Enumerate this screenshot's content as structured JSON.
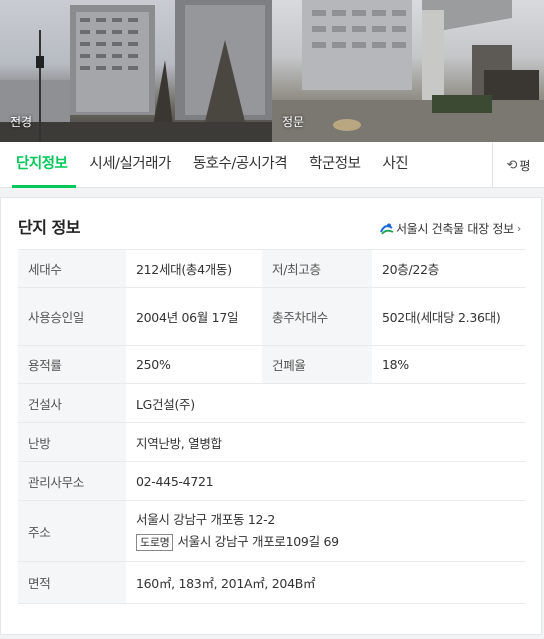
{
  "photos": [
    {
      "label": "전경"
    },
    {
      "label": "정문"
    }
  ],
  "tabs": [
    {
      "label": "단지정보",
      "active": true
    },
    {
      "label": "시세/실거래가"
    },
    {
      "label": "동호수/공시가격"
    },
    {
      "label": "학군정보"
    },
    {
      "label": "사진"
    }
  ],
  "tab_right": {
    "label": "평",
    "icon": "refresh-icon"
  },
  "card": {
    "title": "단지 정보",
    "link_label": "서울시 건축물 대장 정보"
  },
  "rows": {
    "households_label": "세대수",
    "households_value": "212세대(총4개동)",
    "floors_label": "저/최고층",
    "floors_value": "20층/22층",
    "approval_label": "사용승인일",
    "approval_value": "2004년 06월 17일",
    "parking_label": "총주차대수",
    "parking_value": "502대(세대당 2.36대)",
    "far_label": "용적률",
    "far_value": "250%",
    "bcr_label": "건폐율",
    "bcr_value": "18%",
    "builder_label": "건설사",
    "builder_value": "LG건설(주)",
    "heating_label": "난방",
    "heating_value": "지역난방, 열병합",
    "office_label": "관리사무소",
    "office_value": "02-445-4721",
    "address_label": "주소",
    "address_value": "서울시 강남구 개포동 12-2",
    "road_tag": "도로명",
    "road_address": "서울시 강남구 개포로109길 69",
    "area_label": "면적",
    "area_value": "160㎡, 183㎡, 201A㎡, 204B㎡"
  },
  "colors": {
    "accent": "#03c75a"
  }
}
